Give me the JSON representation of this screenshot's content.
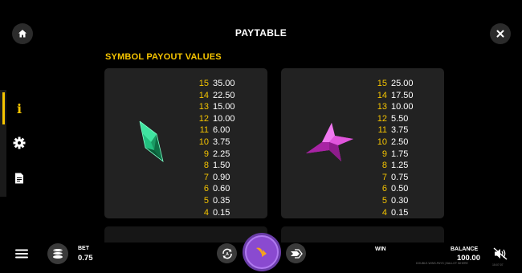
{
  "header": {
    "title": "PAYTABLE"
  },
  "section": {
    "title": "SYMBOL PAYOUT VALUES"
  },
  "sidebar": {
    "tabs": [
      {
        "icon": "info-icon",
        "glyph": "i"
      },
      {
        "icon": "gear-icon"
      },
      {
        "icon": "document-icon"
      }
    ],
    "active_index": 0
  },
  "symbols": [
    {
      "icon": "green-gem-icon",
      "color": "#1fb67a",
      "payouts": [
        {
          "count": "15",
          "value": "35.00"
        },
        {
          "count": "14",
          "value": "22.50"
        },
        {
          "count": "13",
          "value": "15.00"
        },
        {
          "count": "12",
          "value": "10.00"
        },
        {
          "count": "11",
          "value": "6.00"
        },
        {
          "count": "10",
          "value": "3.75"
        },
        {
          "count": "9",
          "value": "2.25"
        },
        {
          "count": "8",
          "value": "1.50"
        },
        {
          "count": "7",
          "value": "0.90"
        },
        {
          "count": "6",
          "value": "0.60"
        },
        {
          "count": "5",
          "value": "0.35"
        },
        {
          "count": "4",
          "value": "0.15"
        }
      ]
    },
    {
      "icon": "pink-star-icon",
      "color": "#d83ad0",
      "payouts": [
        {
          "count": "15",
          "value": "25.00"
        },
        {
          "count": "14",
          "value": "17.50"
        },
        {
          "count": "13",
          "value": "10.00"
        },
        {
          "count": "12",
          "value": "5.50"
        },
        {
          "count": "11",
          "value": "3.75"
        },
        {
          "count": "10",
          "value": "2.50"
        },
        {
          "count": "9",
          "value": "1.75"
        },
        {
          "count": "8",
          "value": "1.25"
        },
        {
          "count": "7",
          "value": "0.75"
        },
        {
          "count": "6",
          "value": "0.50"
        },
        {
          "count": "5",
          "value": "0.30"
        },
        {
          "count": "4",
          "value": "0.15"
        }
      ]
    }
  ],
  "footer": {
    "bet_label": "BET",
    "bet_value": "0.75",
    "win_label": "WIN",
    "balance_label": "BALANCE",
    "balance_value": "100.00",
    "disclaimer": "DOUBLE-WINS-PAYS | BALLOT WHERE",
    "time": "15:07:07"
  },
  "colors": {
    "accent": "#f5c400",
    "panel": "#222222",
    "spin": "#8a4ad0"
  }
}
